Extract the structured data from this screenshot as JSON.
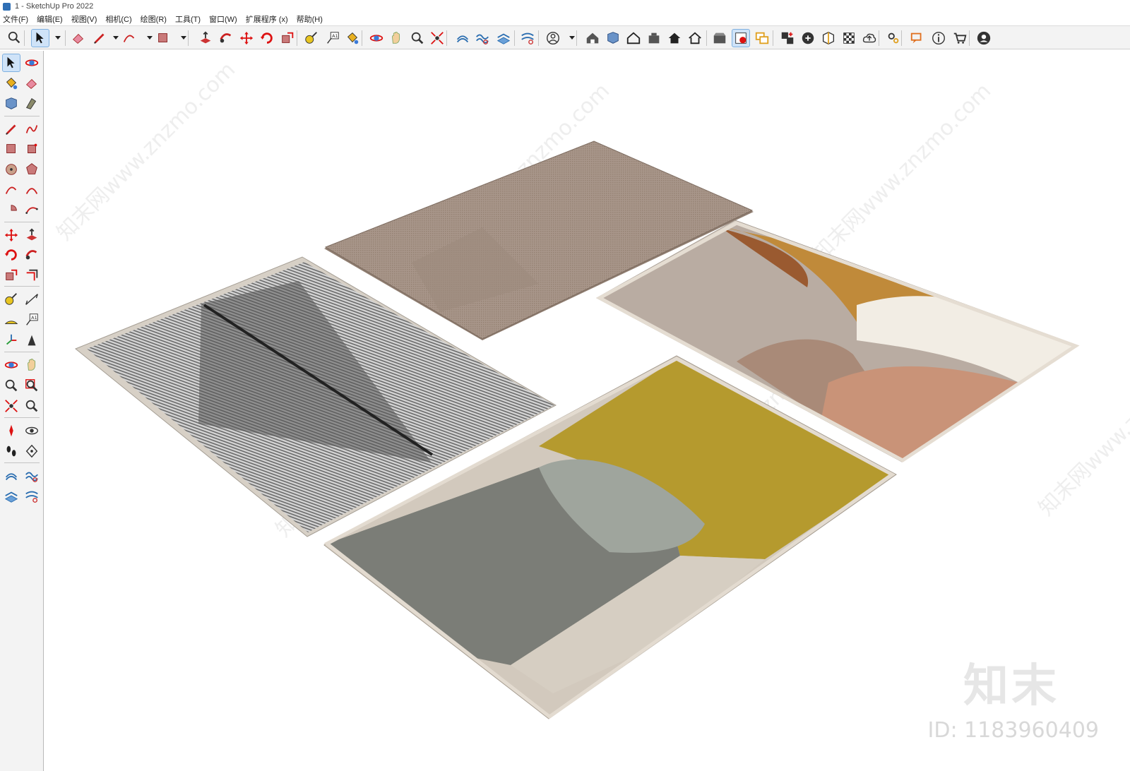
{
  "window": {
    "title": "1 - SketchUp Pro 2022"
  },
  "menu": [
    "文件(F)",
    "编辑(E)",
    "视图(V)",
    "相机(C)",
    "绘图(R)",
    "工具(T)",
    "窗口(W)",
    "扩展程序 (x)",
    "帮助(H)"
  ],
  "toolbar": {
    "icons": [
      "search-zoom-icon",
      "select-arrow-icon",
      "eraser-icon",
      "pencil-line-icon",
      "arc-icon",
      "rectangle-icon",
      "push-pull-icon",
      "follow-me-icon",
      "move-icon",
      "rotate-icon",
      "scale-icon",
      "tape-measure-icon",
      "text-label-icon",
      "paint-bucket-icon",
      "orbit-icon",
      "pan-hand-icon",
      "zoom-icon",
      "zoom-extents-icon",
      "sandbox-from-contours-icon",
      "sandbox-smoove-icon",
      "sandbox-stamp-icon",
      "sandbox-drape-icon",
      "profile-account-icon",
      "warehouse-icon",
      "component-icon",
      "home-view-icon",
      "extension-icon",
      "house-icon",
      "house-outline-icon",
      "warehouse-upload-icon",
      "outliner-icon",
      "layers-icon",
      "add-location-icon",
      "shadow-icon",
      "style-icon",
      "checker-icon",
      "cloud-upload-icon",
      "settings-gear-icon",
      "message-icon",
      "info-icon",
      "cart-icon",
      "account-circle-icon"
    ]
  },
  "left_toolbar": {
    "icons": [
      "select-arrow-icon",
      "orbit-icon",
      "paint-bucket-icon",
      "eraser-icon",
      "component-icon",
      "tag-icon",
      "pencil-line-icon",
      "freehand-icon",
      "rectangle-icon",
      "rotated-rectangle-icon",
      "circle-icon",
      "polygon-icon",
      "arc-icon",
      "two-point-arc-icon",
      "pie-icon",
      "three-point-arc-icon",
      "move-icon",
      "push-pull-icon",
      "rotate-icon",
      "follow-me-icon",
      "scale-icon",
      "offset-icon",
      "tape-measure-icon",
      "dimension-icon",
      "protractor-icon",
      "text-label-icon",
      "axes-icon",
      "3d-text-icon",
      "orbit-icon",
      "pan-hand-icon",
      "zoom-icon",
      "zoom-window-icon",
      "zoom-extents-icon",
      "previous-view-icon",
      "position-camera-icon",
      "look-around-icon",
      "walk-icon",
      "section-plane-icon",
      "sandbox-from-contours-icon",
      "sandbox-smoove-icon",
      "sandbox-stamp-icon",
      "sandbox-drape-icon"
    ]
  },
  "watermark": {
    "logo_text": "知末",
    "id_text": "ID: 1183960409",
    "diagonal_text": "知末网www.znzmo.com"
  },
  "colors": {
    "toolbar_bg": "#f3f3f3",
    "active_tool": "#cfe3f8",
    "rug_beige_border": "#d8d0c5",
    "rug_mustard": "#b59a2e",
    "rug_grey": "#7b7d77",
    "rug_terracotta": "#c98f73",
    "rug_taupe": "#a79282"
  }
}
